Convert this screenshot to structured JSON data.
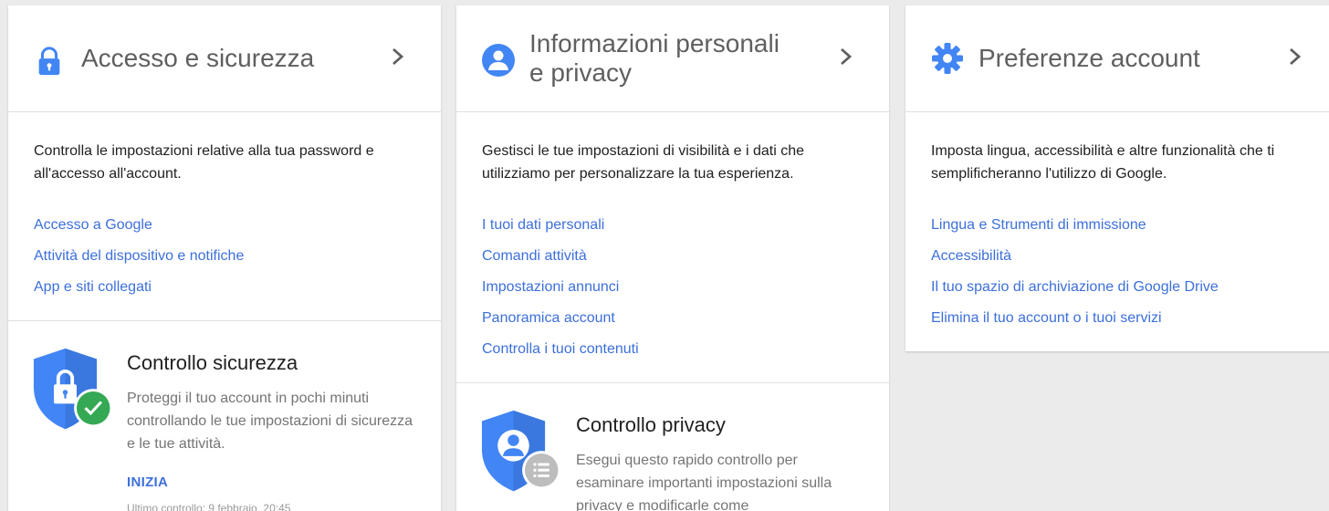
{
  "cards": [
    {
      "title": "Accesso e sicurezza",
      "icon": "lock-icon",
      "description": "Controlla le impostazioni relative alla tua password e all'accesso all'account.",
      "links": [
        "Accesso a Google",
        "Attività del dispositivo e notifiche",
        "App e siti collegati"
      ]
    },
    {
      "title_line1": "Informazioni personali",
      "title_line2": "e privacy",
      "icon": "person-icon",
      "description": "Gestisci le tue impostazioni di visibilità e i dati che utilizziamo per personalizzare la tua esperienza.",
      "links": [
        "I tuoi dati personali",
        "Comandi attività",
        "Impostazioni annunci",
        "Panoramica account",
        "Controlla i tuoi contenuti"
      ]
    },
    {
      "title": "Preferenze account",
      "icon": "gear-icon",
      "description": "Imposta lingua, accessibilità e altre funzionalità che ti semplificheranno l'utilizzo di Google.",
      "links": [
        "Lingua e Strumenti di immissione",
        "Accessibilità",
        "Il tuo spazio di archiviazione di Google Drive",
        "Elimina il tuo account o i tuoi servizi"
      ]
    }
  ],
  "security_check": {
    "title": "Controllo sicurezza",
    "description": "Proteggi il tuo account in pochi minuti controllando le tue impostazioni di sicurezza e le tue attività.",
    "action": "INIZIA",
    "last_check": "Ultimo controllo: 9 febbraio, 20:45"
  },
  "privacy_check": {
    "title": "Controllo privacy",
    "description": "Esegui questo rapido controllo per esaminare importanti impostazioni sulla privacy e modificarle come"
  },
  "colors": {
    "accent": "#4285f4",
    "link": "#3c6fdc",
    "green": "#34a853",
    "background": "#ebebeb"
  }
}
